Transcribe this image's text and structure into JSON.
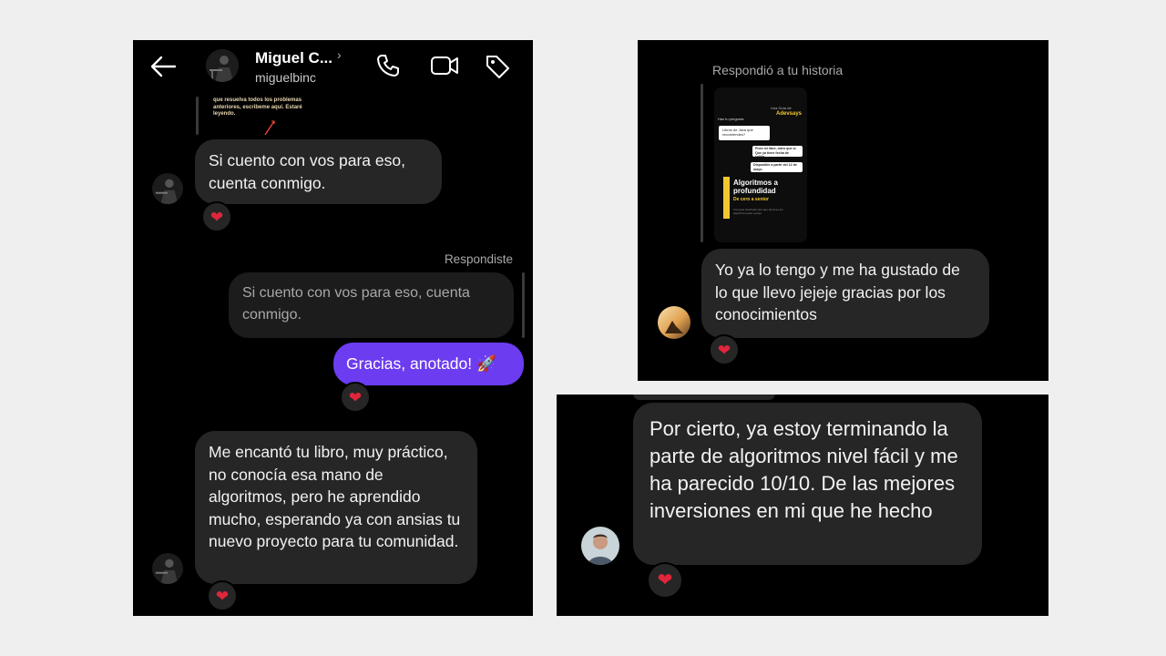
{
  "panel1": {
    "header": {
      "name": "Miguel C...",
      "username": "miguelbinc",
      "back_icon": "arrow-left-icon",
      "call_icon": "phone-icon",
      "video_icon": "video-camera-icon",
      "tag_icon": "tag-icon"
    },
    "snippet_text": "que resuelva todos los problemas anteriores, escribeme aquí. Estaré leyendo.",
    "messages": {
      "m1": "Si cuento con vos para eso, cuenta conmigo.",
      "reply_label": "Respondiste",
      "quoted": "Si cuento con vos para eso, cuenta conmigo.",
      "sent": "Gracias, anotado! 🚀",
      "m2": "Me encantó tu libro, muy práctico, no conocía esa mano de algoritmos, pero he aprendido mucho, esperando ya con ansias tu nuevo proyecto para tu comunidad."
    },
    "reaction": "❤"
  },
  "panel2": {
    "reply_label": "Respondió a tu historia",
    "story": {
      "brand_small": "Una Guía de",
      "brand": "Adevsays",
      "q_label": "Haz tu pregunta",
      "q_text": "Libros de Java que recomiendes?",
      "r1": "Pues mi libro, claro que sí. Que ya tiene fecha de salida.",
      "r2": "Disponible a partir del 12 de mayo.",
      "title": "Algoritmos a profundidad",
      "subtitle": "De cero a senior",
      "footer": "Una guía diseñada para que domines los algoritmos paso a paso"
    },
    "message": "Yo ya lo tengo y me ha gustado de lo que llevo jejeje gracias por los conocimientos",
    "reaction": "❤"
  },
  "panel3": {
    "message": "Por cierto, ya estoy terminando la parte de algoritmos nivel fácil y me ha parecido 10/10. De las mejores inversiones en mi que he hecho",
    "reaction": "❤"
  },
  "colors": {
    "accent": "#6c3cf0",
    "bubble": "#262626",
    "heart": "#e0263c"
  }
}
